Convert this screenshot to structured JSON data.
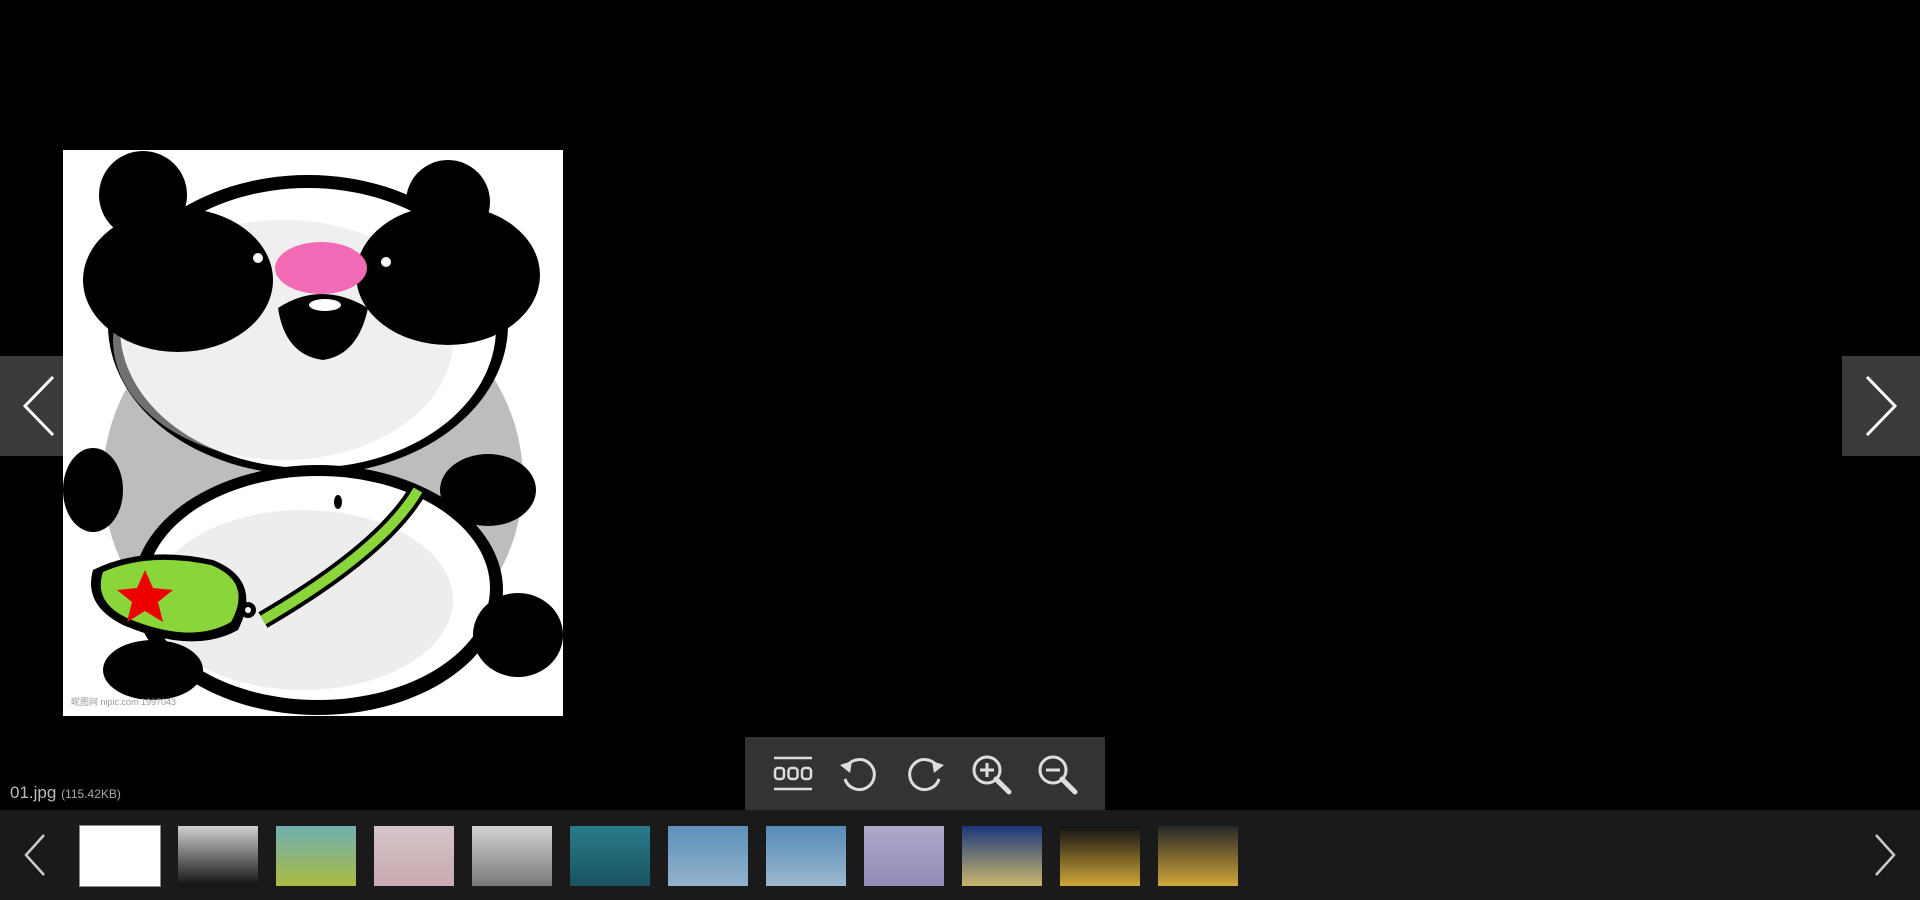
{
  "viewer": {
    "file_name": "01.jpg",
    "file_size": "(115.42KB)",
    "watermark": "昵图网 nipic.com 1997043"
  },
  "toolbar": {
    "buttons": [
      {
        "name": "thumbnails",
        "icon": "grid-icon"
      },
      {
        "name": "rotate-left",
        "icon": "rotate-ccw-icon"
      },
      {
        "name": "rotate-right",
        "icon": "rotate-cw-icon"
      },
      {
        "name": "zoom-in",
        "icon": "zoom-in-icon"
      },
      {
        "name": "zoom-out",
        "icon": "zoom-out-icon"
      }
    ]
  },
  "thumbnails": {
    "active_index": 0,
    "items": [
      {
        "file": "01.jpg",
        "colors": [
          "#ffffff",
          "#ffffff"
        ]
      },
      {
        "file": "panda",
        "colors": [
          "#f0f0f0",
          "#111111"
        ]
      },
      {
        "file": "landscape",
        "colors": [
          "#7fc9c9",
          "#c6d94a"
        ]
      },
      {
        "file": "blossom",
        "colors": [
          "#f5e3e6",
          "#e8c4cc"
        ]
      },
      {
        "file": "sketch",
        "colors": [
          "#f2f2f2",
          "#8a8a8a"
        ]
      },
      {
        "file": "teal",
        "colors": [
          "#2d8e9e",
          "#1a5c6e"
        ]
      },
      {
        "file": "sky",
        "colors": [
          "#6aa6d8",
          "#a8cdeb"
        ]
      },
      {
        "file": "sky2",
        "colors": [
          "#5f9fd4",
          "#b3d4ee"
        ]
      },
      {
        "file": "flowers",
        "colors": [
          "#c7c3e8",
          "#a89fd4"
        ]
      },
      {
        "file": "night",
        "colors": [
          "#1c3d8e",
          "#e8d27a"
        ]
      },
      {
        "file": "eagle",
        "colors": [
          "#111111",
          "#f0c040"
        ]
      },
      {
        "file": "eagle2",
        "colors": [
          "#2a2a2a",
          "#f0c040"
        ]
      }
    ]
  }
}
